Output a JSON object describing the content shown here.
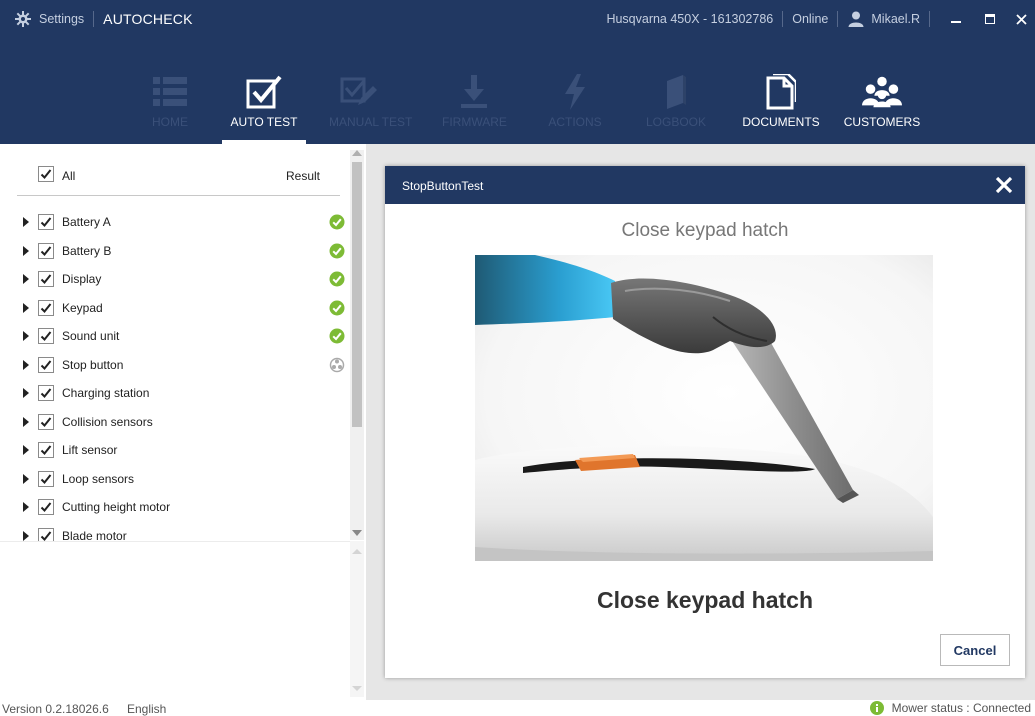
{
  "titlebar": {
    "settings_label": "Settings",
    "app_title": "AUTOCHECK",
    "device": "Husqvarna 450X - 161302786",
    "connection": "Online",
    "user": "Mikael.R"
  },
  "nav": {
    "items": [
      {
        "label": "HOME",
        "icon": "list-icon",
        "enabled": false
      },
      {
        "label": "AUTO TEST",
        "icon": "checkbox-icon",
        "enabled": true,
        "active": true
      },
      {
        "label": "MANUAL TEST",
        "icon": "pencil-check-icon",
        "enabled": false
      },
      {
        "label": "FIRMWARE",
        "icon": "download-icon",
        "enabled": false
      },
      {
        "label": "ACTIONS",
        "icon": "lightning-icon",
        "enabled": false
      },
      {
        "label": "LOGBOOK",
        "icon": "book-icon",
        "enabled": false
      },
      {
        "label": "DOCUMENTS",
        "icon": "documents-icon",
        "enabled": true
      },
      {
        "label": "CUSTOMERS",
        "icon": "people-icon",
        "enabled": true
      }
    ]
  },
  "test_list": {
    "header_all": "All",
    "header_result": "Result",
    "items": [
      {
        "label": "Battery A",
        "result": "pass"
      },
      {
        "label": "Battery B",
        "result": "pass"
      },
      {
        "label": "Display",
        "result": "pass"
      },
      {
        "label": "Keypad",
        "result": "pass"
      },
      {
        "label": "Sound unit",
        "result": "pass"
      },
      {
        "label": "Stop button",
        "result": "running"
      },
      {
        "label": "Charging station",
        "result": ""
      },
      {
        "label": "Collision sensors",
        "result": ""
      },
      {
        "label": "Lift sensor",
        "result": ""
      },
      {
        "label": "Loop sensors",
        "result": ""
      },
      {
        "label": "Cutting height motor",
        "result": ""
      },
      {
        "label": "Blade motor",
        "result": ""
      }
    ]
  },
  "dialog": {
    "title": "StopButtonTest",
    "instruction_top": "Close keypad hatch",
    "instruction_main": "Close keypad hatch",
    "cancel_label": "Cancel"
  },
  "statusbar": {
    "version": "Version 0.2.18026.6",
    "language": "English",
    "mower_status": "Mower status : Connected"
  },
  "colors": {
    "navy": "#213862",
    "pass_green": "#7dbb35",
    "disabled_nav": "#3a5079",
    "hatch_orange": "#e0752c"
  }
}
